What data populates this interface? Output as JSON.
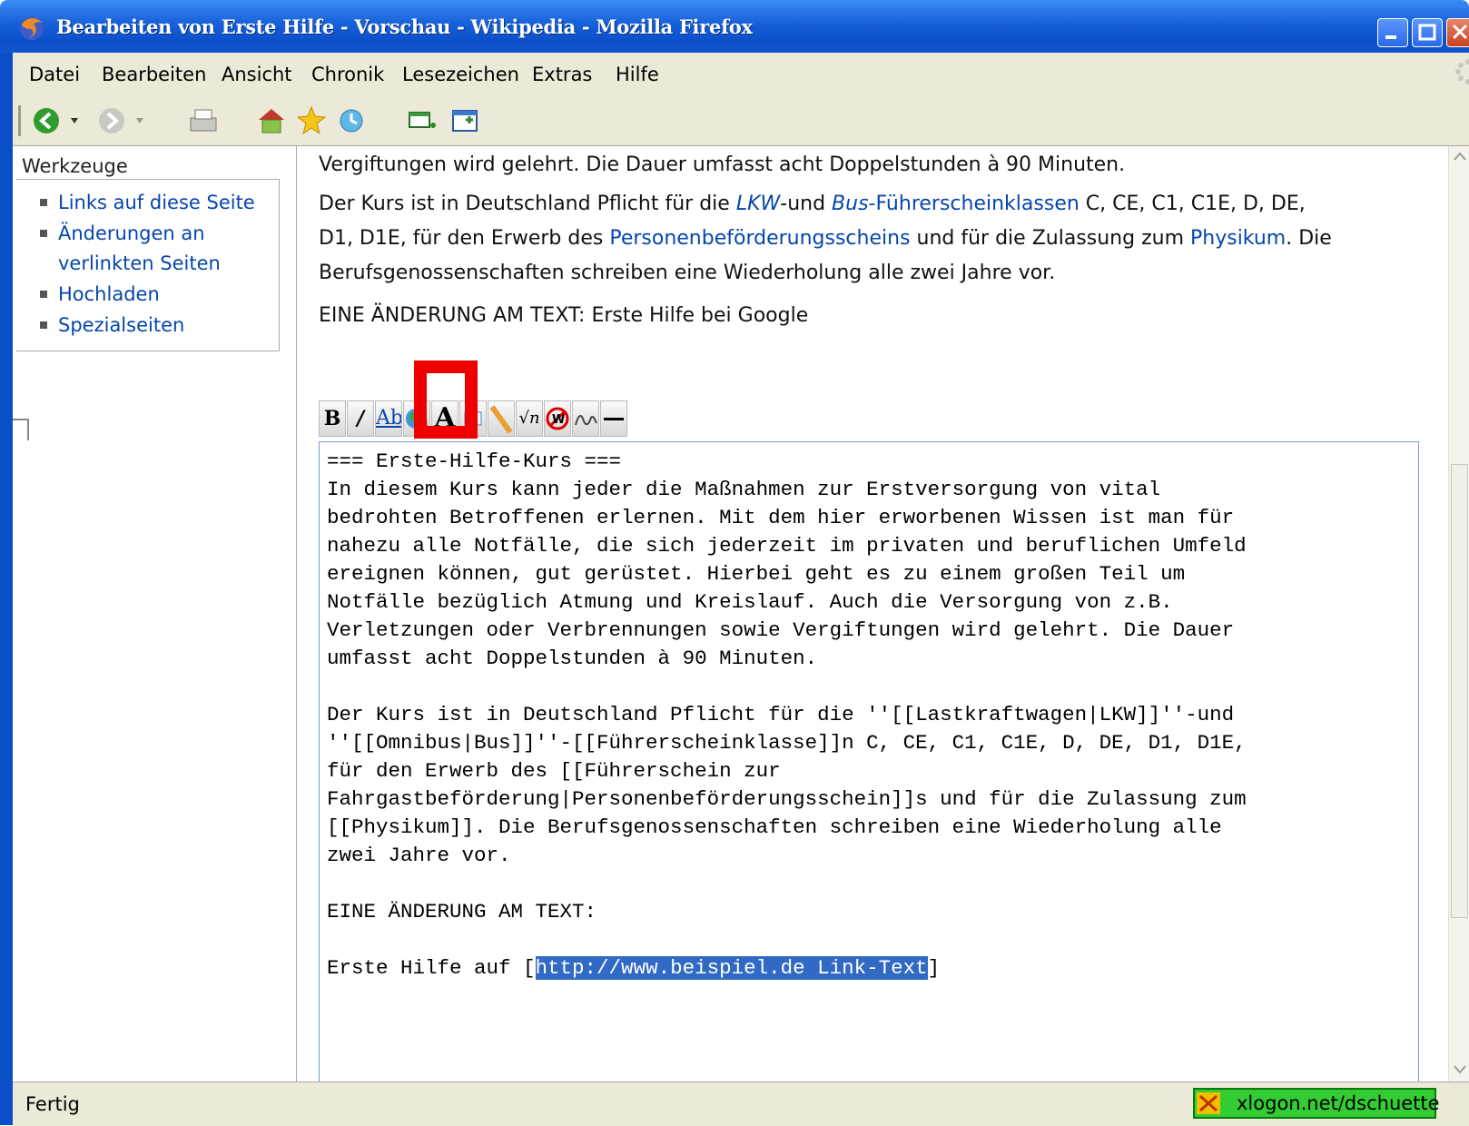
{
  "window": {
    "title": "Bearbeiten von Erste Hilfe - Vorschau - Wikipedia - Mozilla Firefox"
  },
  "menu": {
    "items": [
      "Datei",
      "Bearbeiten",
      "Ansicht",
      "Chronik",
      "Lesezeichen",
      "Extras",
      "Hilfe"
    ]
  },
  "toolbar": {
    "icons": [
      "back-icon",
      "forward-icon",
      "print-icon",
      "home-icon",
      "bookmark-star-icon",
      "history-icon",
      "new-window-icon",
      "new-tab-icon"
    ]
  },
  "sidebar": {
    "heading": "Werkzeuge",
    "items": [
      "Links auf diese Seite",
      "Änderungen an",
      "verlinkten Seiten",
      "Hochladen",
      "Spezialseiten"
    ]
  },
  "preview": {
    "p1": "Vergiftungen wird gelehrt. Die Dauer umfasst acht Doppelstunden à 90 Minuten.",
    "p2_a": "Der Kurs ist in Deutschland Pflicht für die ",
    "p2_link1": "LKW",
    "p2_b": "-und ",
    "p2_link2": "Bus",
    "p2_link3": "-Führerscheinklassen",
    "p2_c": " C, CE, C1, C1E, D, DE,",
    "p2_d": "D1, D1E, für den Erwerb des ",
    "p2_link4": "Personenbeförderungsscheins",
    "p2_e": " und für die Zulassung zum ",
    "p2_link5": "Physikum",
    "p2_f": ". Die",
    "p2_g": "Berufsgenossenschaften schreiben eine Wiederholung alle zwei Jahre vor.",
    "p3": "EINE ÄNDERUNG AM TEXT: Erste Hilfe bei Google"
  },
  "editor_toolbar": {
    "buttons": [
      "bold-icon",
      "italic-icon",
      "internal-link-icon",
      "external-link-icon",
      "headline-icon",
      "image-icon",
      "media-icon",
      "math-icon",
      "nowiki-icon",
      "signature-icon",
      "horizontal-line-icon"
    ]
  },
  "editor": {
    "text_before": "=== Erste-Hilfe-Kurs ===\nIn diesem Kurs kann jeder die Maßnahmen zur Erstversorgung von vital\nbedrohten Betroffenen erlernen. Mit dem hier erworbenen Wissen ist man für\nnahezu alle Notfälle, die sich jederzeit im privaten und beruflichen Umfeld\nereignen können, gut gerüstet. Hierbei geht es zu einem großen Teil um\nNotfälle bezüglich Atmung und Kreislauf. Auch die Versorgung von z.B.\nVerletzungen oder Verbrennungen sowie Vergiftungen wird gelehrt. Die Dauer\numfasst acht Doppelstunden à 90 Minuten.\n\nDer Kurs ist in Deutschland Pflicht für die ''[[Lastkraftwagen|LKW]]''-und\n''[[Omnibus|Bus]]''-[[Führerscheinklasse]]n C, CE, C1, C1E, D, DE, D1, D1E,\nfür den Erwerb des [[Führerschein zur\nFahrgastbeförderung|Personenbeförderungsschein]]s und für die Zulassung zum\n[[Physikum]]. Die Berufsgenossenschaften schreiben eine Wiederholung alle\nzwei Jahre vor.\n\nEINE ÄNDERUNG AM TEXT:\n\nErste Hilfe auf [",
    "selected_text": "http://www.beispiel.de Link-Text",
    "text_after": "]"
  },
  "status": {
    "text": "Fertig",
    "addon_label": "xlogon.net/dschuette"
  },
  "colors": {
    "link": "#0645ad",
    "selection": "#316ac5",
    "highlight_box": "#ee0000",
    "titlebar": "#0b4fc8"
  }
}
